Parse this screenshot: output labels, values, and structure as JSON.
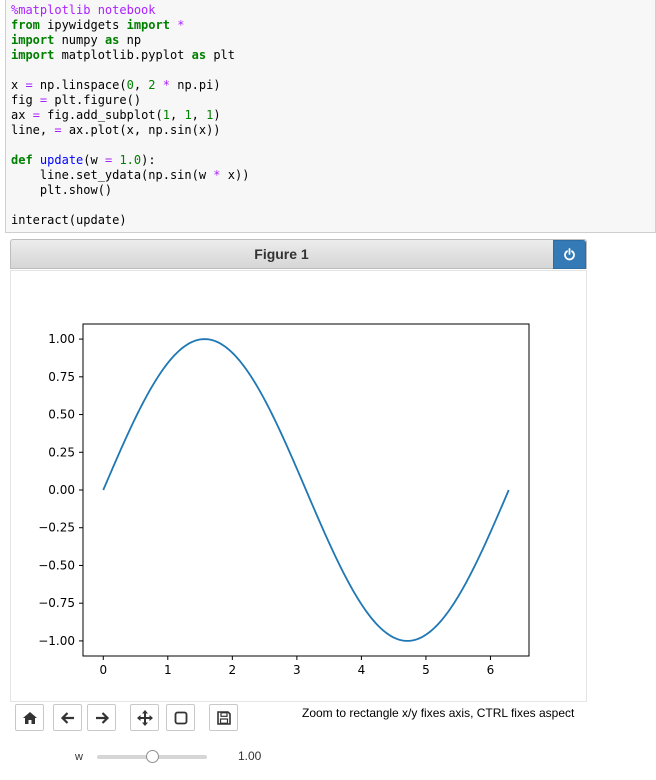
{
  "code_cell": {
    "lines": [
      "%matplotlib notebook",
      "from ipywidgets import *",
      "import numpy as np",
      "import matplotlib.pyplot as plt",
      "",
      "x = np.linspace(0, 2 * np.pi)",
      "fig = plt.figure()",
      "ax = fig.add_subplot(1, 1, 1)",
      "line, = ax.plot(x, np.sin(x))",
      "",
      "def update(w = 1.0):",
      "    line.set_ydata(np.sin(w * x))",
      "    plt.show()",
      "",
      "interact(update)"
    ]
  },
  "figure": {
    "title": "Figure 1",
    "power_button_icon": "power-icon"
  },
  "chart_data": {
    "type": "line",
    "title": "",
    "xlabel": "",
    "ylabel": "",
    "xlim": [
      -0.314,
      6.597
    ],
    "ylim": [
      -1.1,
      1.1
    ],
    "x_ticks": [
      "0",
      "1",
      "2",
      "3",
      "4",
      "5",
      "6"
    ],
    "y_ticks": [
      "1.00",
      "0.75",
      "0.50",
      "0.25",
      "0.00",
      "−0.25",
      "−0.50",
      "−0.75",
      "−1.00"
    ],
    "grid": false,
    "series": [
      {
        "function": "sin(x)",
        "x_range": [
          0,
          6.283
        ],
        "points": 50,
        "color": "#1f77b4"
      }
    ]
  },
  "toolbar": {
    "buttons": [
      {
        "name": "home-button",
        "icon": "home-icon"
      },
      {
        "name": "back-button",
        "icon": "arrow-left-icon"
      },
      {
        "name": "forward-button",
        "icon": "arrow-right-icon"
      },
      {
        "name": "pan-button",
        "icon": "move-icon"
      },
      {
        "name": "zoom-button",
        "icon": "square-icon"
      },
      {
        "name": "save-button",
        "icon": "floppy-disk-icon"
      }
    ],
    "status": "Zoom to rectangle x/y fixes axis, CTRL fixes aspect"
  },
  "slider": {
    "label": "w",
    "value": "1.00",
    "level": 0.5
  }
}
